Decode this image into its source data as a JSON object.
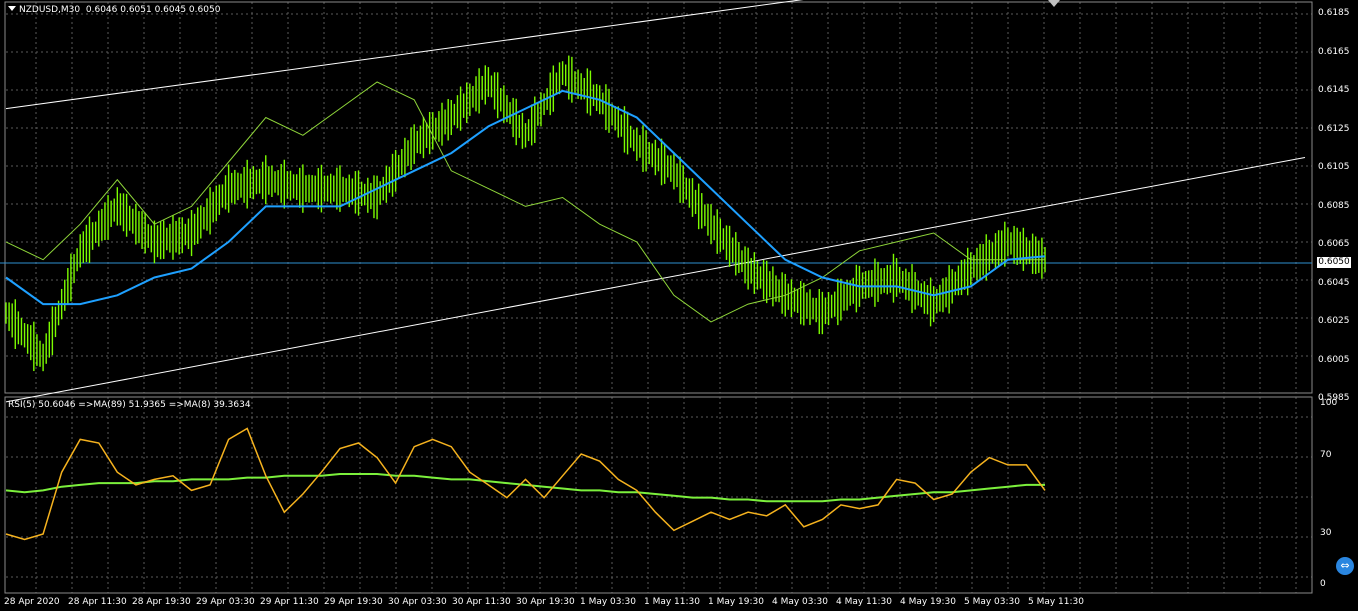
{
  "header": {
    "symbol": "NZDUSD,M30",
    "ohlc": "0.6046 0.6051 0.6045 0.6050"
  },
  "rsi_header": {
    "text": "RSI(5) 50.6046 =>MA(89) 51.9365 =>MA(8) 39.3634"
  },
  "current_price": "0.6050",
  "price_axis": [
    "0.6185",
    "0.6165",
    "0.6145",
    "0.6125",
    "0.6105",
    "0.6085",
    "0.6065",
    "0.6045",
    "0.6025",
    "0.6005",
    "0.5985"
  ],
  "rsi_axis": [
    "100",
    "70",
    "30",
    "0"
  ],
  "time_axis": [
    "28 Apr 2020",
    "28 Apr 11:30",
    "28 Apr 19:30",
    "29 Apr 03:30",
    "29 Apr 11:30",
    "29 Apr 19:30",
    "30 Apr 03:30",
    "30 Apr 11:30",
    "30 Apr 19:30",
    "1 May 03:30",
    "1 May 11:30",
    "1 May 19:30",
    "4 May 03:30",
    "4 May 11:30",
    "4 May 19:30",
    "5 May 03:30",
    "5 May 11:30"
  ],
  "colors": {
    "background": "#000000",
    "grid": "#5a5a5a",
    "candles": "#7cfc00",
    "ma_price": "#1ea0ff",
    "thin_line": "#8fd63a",
    "rsi": "#f5b21e",
    "rsi_ma": "#7cf03c",
    "channel": "#ffffff",
    "icon": "#2a86e0"
  },
  "icons": {
    "corner": "teamviewer-icon",
    "shift": "chart-shift-triangle-icon",
    "menu": "menu-triangle-icon"
  },
  "chart_data": [
    {
      "type": "candlestick",
      "symbol": "NZDUSD",
      "timeframe": "M30",
      "ylim": [
        0.5975,
        0.6195
      ],
      "x": [
        0,
        6,
        12,
        18,
        24,
        30,
        36,
        42,
        48,
        54,
        60,
        66,
        72,
        78,
        84,
        90,
        96,
        102,
        108,
        114,
        120,
        126,
        132,
        138,
        144,
        150,
        156,
        162,
        168
      ],
      "close": [
        0.602,
        0.5995,
        0.6055,
        0.608,
        0.606,
        0.6065,
        0.609,
        0.6095,
        0.609,
        0.609,
        0.6085,
        0.6115,
        0.613,
        0.615,
        0.612,
        0.6155,
        0.614,
        0.6115,
        0.61,
        0.607,
        0.6045,
        0.603,
        0.602,
        0.6035,
        0.604,
        0.6025,
        0.6045,
        0.606,
        0.605
      ],
      "ma_fast": [
        0.604,
        0.6025,
        0.6025,
        0.603,
        0.604,
        0.6045,
        0.606,
        0.608,
        0.608,
        0.608,
        0.609,
        0.61,
        0.611,
        0.6125,
        0.6135,
        0.6145,
        0.614,
        0.613,
        0.611,
        0.609,
        0.607,
        0.605,
        0.604,
        0.6035,
        0.6035,
        0.603,
        0.6035,
        0.605,
        0.6052
      ],
      "ma_slow": [
        0.606,
        0.605,
        0.607,
        0.6095,
        0.607,
        0.608,
        0.6105,
        0.613,
        0.612,
        0.6135,
        0.615,
        0.614,
        0.61,
        0.609,
        0.608,
        0.6085,
        0.607,
        0.606,
        0.603,
        0.6015,
        0.6025,
        0.603,
        0.604,
        0.6055,
        0.606,
        0.6065,
        0.605,
        0.605,
        0.605
      ],
      "channel": {
        "upper": {
          "from": [
            0,
            0.6135
          ],
          "to": [
            168,
            0.6215
          ]
        },
        "lower": {
          "from": [
            0,
            0.597
          ],
          "to": [
            168,
            0.608
          ]
        }
      }
    },
    {
      "type": "line",
      "indicator": "RSI",
      "ylim": [
        0,
        100
      ],
      "ticks": [
        100,
        70,
        30,
        0
      ],
      "x": [
        0,
        3,
        6,
        9,
        12,
        15,
        18,
        21,
        24,
        27,
        30,
        33,
        36,
        39,
        42,
        45,
        48,
        51,
        54,
        57,
        60,
        63,
        66,
        69,
        72,
        75,
        78,
        81,
        84,
        87,
        90,
        93,
        96,
        99,
        102,
        105,
        108,
        111,
        114,
        117,
        120,
        123,
        126,
        129,
        132,
        135,
        138,
        141,
        144,
        147,
        150,
        153,
        156,
        159,
        162,
        165,
        168
      ],
      "series": [
        {
          "values": [
            28,
            25,
            28,
            62,
            80,
            78,
            62,
            55,
            58,
            60,
            52,
            55,
            80,
            86,
            60,
            40,
            50,
            62,
            75,
            78,
            70,
            56,
            76,
            80,
            76,
            62,
            55,
            48,
            58,
            48,
            60,
            72,
            68,
            58,
            52,
            40,
            30,
            35,
            40,
            36,
            40,
            38,
            44,
            32,
            36,
            44,
            42,
            44,
            58,
            56,
            47,
            50,
            62,
            70,
            66,
            66,
            52
          ]
        },
        {
          "values": [
            52,
            51,
            52,
            54,
            55,
            56,
            56,
            56,
            57,
            57,
            58,
            58,
            58,
            59,
            59,
            60,
            60,
            60,
            61,
            61,
            61,
            60,
            60,
            59,
            58,
            58,
            57,
            56,
            55,
            54,
            53,
            52,
            52,
            51,
            51,
            50,
            49,
            48,
            48,
            47,
            47,
            46,
            46,
            46,
            46,
            47,
            47,
            48,
            49,
            50,
            51,
            51,
            52,
            53,
            54,
            55,
            55
          ]
        }
      ]
    }
  ]
}
